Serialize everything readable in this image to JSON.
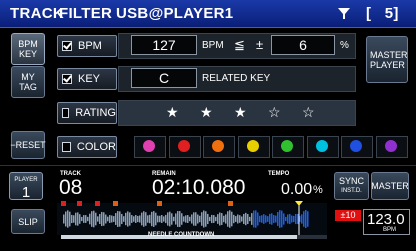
{
  "header": {
    "title": "TRACK",
    "filter": "FILTER",
    "source": "USB@PLAYER1",
    "count": "[   5]"
  },
  "sidebar": {
    "bpm_key": "BPM KEY",
    "my_tag": "MY TAG",
    "reset": "−RESET",
    "master_player": "MASTER PLAYER"
  },
  "filters": {
    "bpm": {
      "label": "BPM",
      "checked": true,
      "value": "127",
      "unit": "BPM",
      "cmp": "≦",
      "pm": "±",
      "range": "6",
      "pct": "%"
    },
    "key": {
      "label": "KEY",
      "checked": true,
      "value": "C",
      "related": "RELATED KEY"
    },
    "rating": {
      "label": "RATING",
      "checked": false,
      "stars": [
        "★",
        "★",
        "★",
        "☆",
        "☆"
      ]
    },
    "color": {
      "label": "COLOR",
      "checked": false,
      "colors": [
        "#e040b0",
        "#e02020",
        "#f07010",
        "#e8d000",
        "#30c030",
        "#00c0e0",
        "#2050e0",
        "#9030d0"
      ]
    }
  },
  "deck": {
    "player_label": "PLAYER",
    "player_num": "1",
    "track_label": "TRACK",
    "track_num": "08",
    "remain_label": "REMAIN",
    "time": "02:10.080",
    "tempo_label": "TEMPO",
    "tempo": "0.00",
    "tempo_pct": "%",
    "sync": "SYNC",
    "inst": "INST.D.",
    "master": "MASTER",
    "slip": "SLIP",
    "range": "±10",
    "bpm": "123.0",
    "bpm_unit": "BPM",
    "needle": "NEEDLE COUNTDOWN"
  }
}
